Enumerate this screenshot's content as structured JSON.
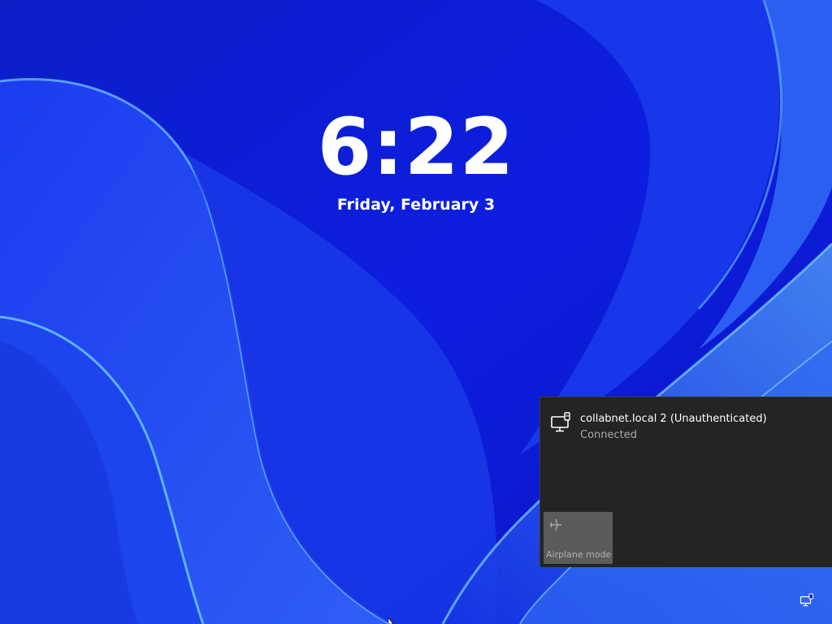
{
  "lockscreen": {
    "time": "6:22",
    "date": "Friday, February 3"
  },
  "network_flyout": {
    "network_name": "collabnet.local 2 (Unauthenticated)",
    "network_status": "Connected",
    "network_icon": "ethernet-monitor-icon",
    "airplane_tile": {
      "label": "Airplane mode",
      "icon": "airplane-icon",
      "state": "off"
    }
  },
  "system_tray": {
    "network_icon": "ethernet-monitor-icon"
  },
  "colors": {
    "wallpaper_base": "#0a1bd0",
    "flyout_background": "#242424",
    "tile_background": "#5b5b5b",
    "primary_text": "#ffffff",
    "secondary_text": "#a8a8a8"
  }
}
